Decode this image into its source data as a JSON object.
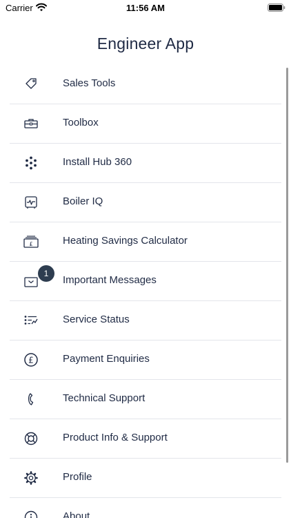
{
  "status_bar": {
    "carrier": "Carrier",
    "time": "11:56 AM"
  },
  "header": {
    "title": "Engineer App"
  },
  "menu": {
    "items": [
      {
        "label": "Sales Tools",
        "icon": "tag-icon"
      },
      {
        "label": "Toolbox",
        "icon": "toolbox-icon"
      },
      {
        "label": "Install Hub 360",
        "icon": "dots-grid-icon"
      },
      {
        "label": "Boiler IQ",
        "icon": "boiler-iq-icon"
      },
      {
        "label": "Heating Savings Calculator",
        "icon": "pound-note-icon"
      },
      {
        "label": "Important Messages",
        "icon": "envelope-icon",
        "badge": "1"
      },
      {
        "label": "Service Status",
        "icon": "service-status-icon"
      },
      {
        "label": "Payment Enquiries",
        "icon": "pound-circle-icon"
      },
      {
        "label": "Technical Support",
        "icon": "phone-icon"
      },
      {
        "label": "Product Info & Support",
        "icon": "lifebuoy-icon"
      },
      {
        "label": "Profile",
        "icon": "gear-icon"
      },
      {
        "label": "About",
        "icon": "info-icon"
      }
    ]
  },
  "colors": {
    "text": "#1f2a44",
    "separator": "#e3e5ea",
    "badge": "#2e3d50",
    "scrollbar": "#9a9a9a"
  }
}
